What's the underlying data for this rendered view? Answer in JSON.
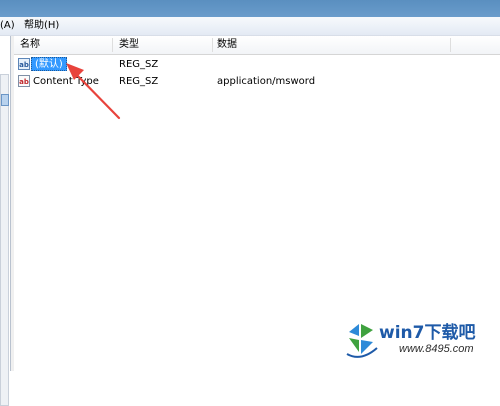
{
  "menu": {
    "items": [
      {
        "label": "(A)"
      },
      {
        "label": "帮助(H)"
      }
    ]
  },
  "list": {
    "columns": [
      {
        "label": "名称"
      },
      {
        "label": "类型"
      },
      {
        "label": "数据"
      }
    ],
    "rows": [
      {
        "icon": "string-value-icon",
        "icon_text": "ab",
        "name": "(默认)",
        "type": "REG_SZ",
        "data": "",
        "selected": true
      },
      {
        "icon": "string-value-icon",
        "icon_text": "ab",
        "name": "Content Type",
        "type": "REG_SZ",
        "data": "application/msword",
        "selected": false
      }
    ]
  },
  "annotation": {
    "color": "#e8433c",
    "shape": "arrow pointing to selected value"
  },
  "watermark": {
    "logo_icon": "win7-logo-icon",
    "text": "win7下载吧",
    "url": "www.8495.com"
  },
  "colors": {
    "selection": "#3399ff",
    "frame": "#6a9ccb"
  }
}
